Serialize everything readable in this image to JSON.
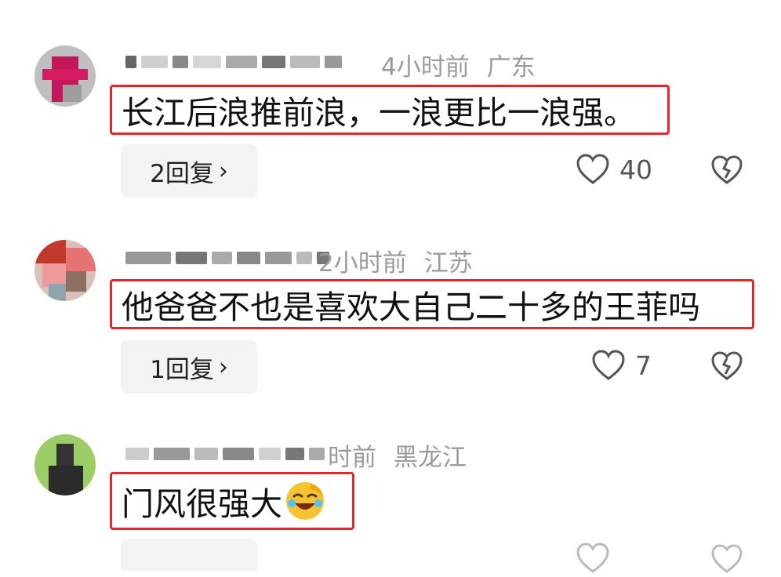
{
  "comments": [
    {
      "time": "4小时前",
      "region": "广东",
      "text": "长江后浪推前浪，一浪更比一浪强。",
      "reply_label": "2回复",
      "likes": "40"
    },
    {
      "time": "2小时前",
      "region": "江苏",
      "text": "他爸爸不也是喜欢大自己二十多的王菲吗",
      "reply_label": "1回复",
      "likes": "7"
    },
    {
      "time": "时前",
      "region": "黑龙江",
      "text": "门风很强大",
      "reply_label": "",
      "likes": ""
    }
  ],
  "icons": {
    "like": "heart-outline-icon",
    "dislike": "broken-heart-icon",
    "chevron": "chevron-right-icon",
    "emoji": "laugh-cry-emoji-icon"
  },
  "colors": {
    "highlight_border": "#e2282b",
    "meta_text": "#9b9b9b",
    "reply_bg": "#f3f3f3"
  }
}
